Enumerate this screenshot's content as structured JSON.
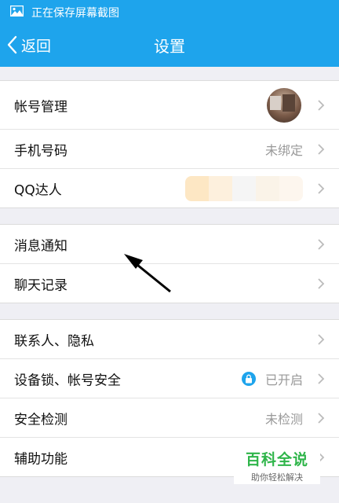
{
  "statusbar": {
    "text": "正在保存屏幕截图",
    "icon": "image-icon"
  },
  "navbar": {
    "back_label": "返回",
    "title": "设置"
  },
  "groups": [
    {
      "rows": [
        {
          "label": "帐号管理",
          "value": "",
          "accessory": "avatar"
        },
        {
          "label": "手机号码",
          "value": "未绑定"
        },
        {
          "label": "QQ达人",
          "value": "",
          "accessory": "badge"
        }
      ]
    },
    {
      "rows": [
        {
          "label": "消息通知",
          "value": ""
        },
        {
          "label": "聊天记录",
          "value": ""
        }
      ]
    },
    {
      "rows": [
        {
          "label": "联系人、隐私",
          "value": ""
        },
        {
          "label": "设备锁、帐号安全",
          "value": "已开启",
          "accessory": "lock-icon"
        },
        {
          "label": "安全检测",
          "value": "未检测"
        },
        {
          "label": "辅助功能",
          "value": ""
        }
      ]
    }
  ],
  "watermark": {
    "title": "百科全说",
    "subtitle": "助你轻松解决"
  },
  "colors": {
    "accent": "#1ea4ec",
    "background": "#efeff4",
    "watermark_green": "#2fb54a"
  }
}
